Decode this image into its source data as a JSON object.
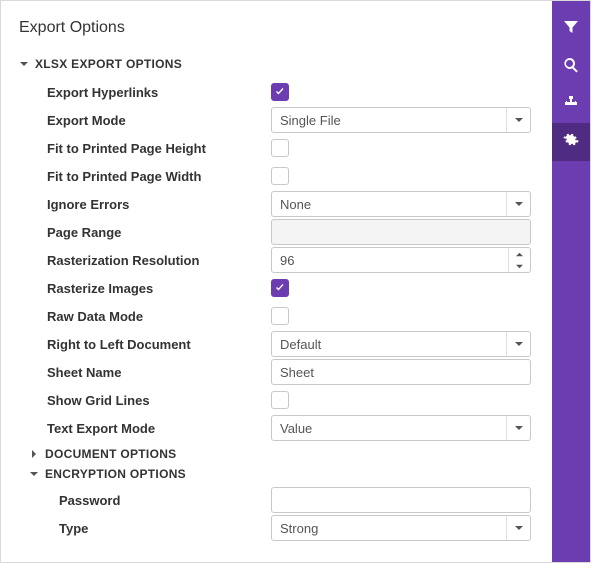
{
  "title": "Export Options",
  "sections": {
    "xlsx": {
      "label": "XLSX EXPORT OPTIONS",
      "fields": {
        "exportHyperlinks": {
          "label": "Export Hyperlinks",
          "checked": true
        },
        "exportMode": {
          "label": "Export Mode",
          "value": "Single File"
        },
        "fitHeight": {
          "label": "Fit to Printed Page Height",
          "checked": false
        },
        "fitWidth": {
          "label": "Fit to Printed Page Width",
          "checked": false
        },
        "ignoreErrors": {
          "label": "Ignore Errors",
          "value": "None"
        },
        "pageRange": {
          "label": "Page Range",
          "value": ""
        },
        "rasterRes": {
          "label": "Rasterization Resolution",
          "value": "96"
        },
        "rasterImages": {
          "label": "Rasterize Images",
          "checked": true
        },
        "rawData": {
          "label": "Raw Data Mode",
          "checked": false
        },
        "rtl": {
          "label": "Right to Left Document",
          "value": "Default"
        },
        "sheetName": {
          "label": "Sheet Name",
          "value": "Sheet"
        },
        "gridLines": {
          "label": "Show Grid Lines",
          "checked": false
        },
        "textMode": {
          "label": "Text Export Mode",
          "value": "Value"
        }
      }
    },
    "document": {
      "label": "DOCUMENT OPTIONS",
      "expanded": false
    },
    "encryption": {
      "label": "ENCRYPTION OPTIONS",
      "expanded": true,
      "fields": {
        "password": {
          "label": "Password",
          "value": ""
        },
        "type": {
          "label": "Type",
          "value": "Strong"
        }
      }
    }
  }
}
